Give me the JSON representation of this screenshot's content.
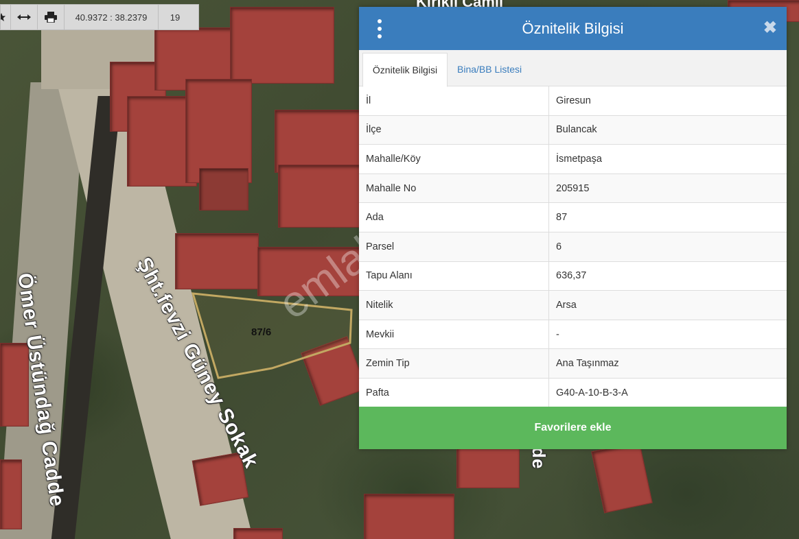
{
  "map": {
    "street_labels": [
      "Ömer Üstündağ Cadde",
      "Şht.fevzi Güney Sokak",
      "de"
    ],
    "mosque_label": "Kirikli Camii",
    "parcel_label": "87/6",
    "watermark": "emlakjet.com"
  },
  "toolbar": {
    "star_icon": "star-icon",
    "measure_icon": "arrows-horizontal-icon",
    "print_icon": "print-icon",
    "coordinates": "40.9372 : 38.2379",
    "zoom": "19"
  },
  "panel": {
    "title": "Öznitelik Bilgisi",
    "tabs": [
      {
        "label": "Öznitelik Bilgisi",
        "active": true
      },
      {
        "label": "Bina/BB Listesi",
        "active": false
      }
    ],
    "rows": [
      {
        "key": "İl",
        "value": "Giresun"
      },
      {
        "key": "İlçe",
        "value": "Bulancak"
      },
      {
        "key": "Mahalle/Köy",
        "value": "İsmetpaşa"
      },
      {
        "key": "Mahalle No",
        "value": "205915"
      },
      {
        "key": "Ada",
        "value": "87"
      },
      {
        "key": "Parsel",
        "value": "6"
      },
      {
        "key": "Tapu Alanı",
        "value": "636,37"
      },
      {
        "key": "Nitelik",
        "value": "Arsa"
      },
      {
        "key": "Mevkii",
        "value": "-"
      },
      {
        "key": "Zemin Tip",
        "value": "Ana Taşınmaz"
      },
      {
        "key": "Pafta",
        "value": "G40-A-10-B-3-A"
      }
    ],
    "favorite_button": "Favorilere ekle",
    "colors": {
      "header": "#3a7dbd",
      "button": "#5cb85c",
      "link": "#3a7dbd"
    }
  }
}
